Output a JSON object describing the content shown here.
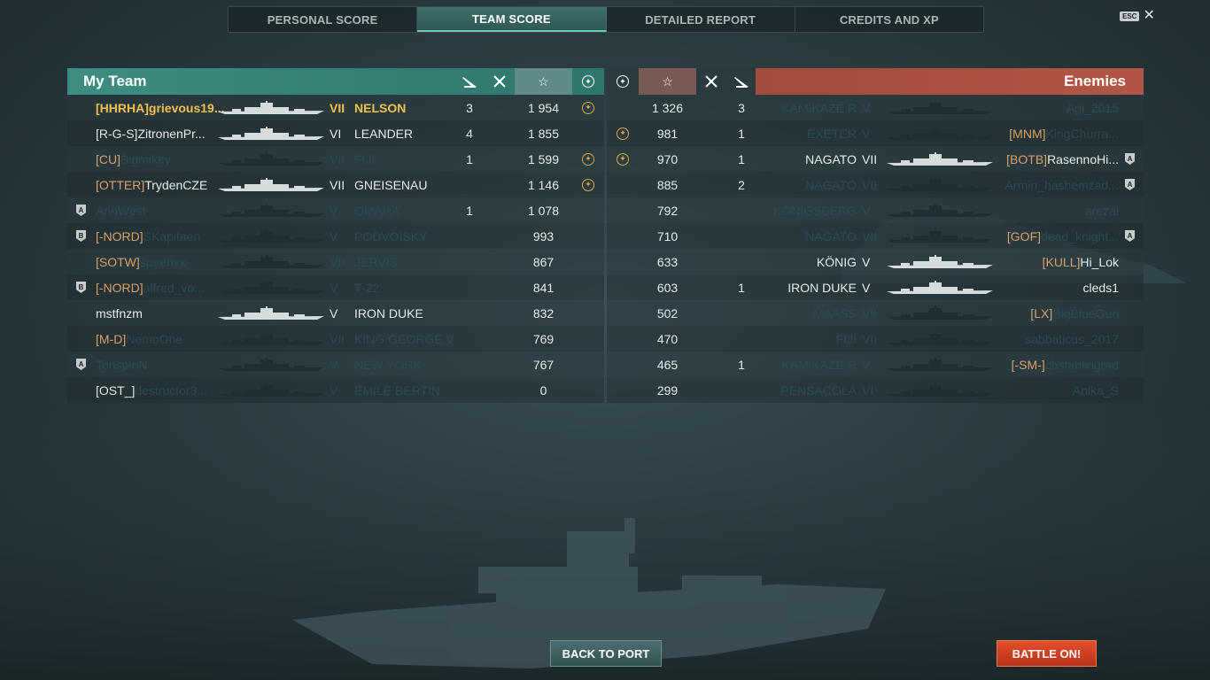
{
  "tabs": [
    {
      "label": "PERSONAL SCORE",
      "active": false
    },
    {
      "label": "TEAM SCORE",
      "active": true
    },
    {
      "label": "DETAILED REPORT",
      "active": false
    },
    {
      "label": "CREDITS AND XP",
      "active": false
    }
  ],
  "esc_label": "ESC",
  "my_team": {
    "title": "My Team",
    "header_icons": [
      "torpedo-icon",
      "planes-icon",
      "star-icon",
      "medal-icon"
    ],
    "rows": [
      {
        "badge": "",
        "clan": "[HHRHA]",
        "player": "grievous19...",
        "tier": "VII",
        "ship": "NELSON",
        "kills": "3",
        "score": "1 954",
        "medal": true,
        "style": "self"
      },
      {
        "badge": "",
        "clan": "[R-G-S]",
        "player": "ZitronenPr...",
        "tier": "VI",
        "ship": "LEANDER",
        "kills": "4",
        "score": "1 855",
        "medal": false,
        "style": "alive-white"
      },
      {
        "badge": "",
        "clan": "[CU]",
        "player": "Bigmikey",
        "tier": "VII",
        "ship": "FIJI",
        "kills": "1",
        "score": "1 599",
        "medal": true,
        "style": "dead"
      },
      {
        "badge": "",
        "clan": "[OTTER]",
        "player": "TrydenCZE",
        "tier": "VII",
        "ship": "GNEISENAU",
        "kills": "",
        "score": "1 146",
        "medal": true,
        "style": "alive"
      },
      {
        "badge": "A",
        "clan": "",
        "player": "AnnWest",
        "tier": "V",
        "ship": "OMAHA",
        "kills": "1",
        "score": "1 078",
        "medal": false,
        "style": "dead"
      },
      {
        "badge": "B",
        "clan": "[-NORD]",
        "player": "SKapitaen",
        "tier": "V",
        "ship": "PODVOISKY",
        "kills": "",
        "score": "993",
        "medal": false,
        "style": "dead"
      },
      {
        "badge": "",
        "clan": "[SOTW]",
        "player": "speenyx",
        "tier": "VII",
        "ship": "JERVIS",
        "kills": "",
        "score": "867",
        "medal": false,
        "style": "dead"
      },
      {
        "badge": "B",
        "clan": "[-NORD]",
        "player": "alfred_vo...",
        "tier": "V",
        "ship": "T-22",
        "kills": "",
        "score": "841",
        "medal": false,
        "style": "dead"
      },
      {
        "badge": "",
        "clan": "",
        "player": "mstfnzm",
        "tier": "V",
        "ship": "IRON DUKE",
        "kills": "",
        "score": "832",
        "medal": false,
        "style": "alive"
      },
      {
        "badge": "",
        "clan": "[M-D]",
        "player": "NemoOne",
        "tier": "VII",
        "ship": "KING GEORGE V",
        "kills": "",
        "score": "769",
        "medal": false,
        "style": "dead"
      },
      {
        "badge": "A",
        "clan": "",
        "player": "TonspioN",
        "tier": "V",
        "ship": "NEW YORK",
        "kills": "",
        "score": "767",
        "medal": false,
        "style": "dead"
      },
      {
        "badge": "",
        "clan": "[OST_]",
        "player": "destructor3...",
        "tier": "V",
        "ship": "ÉMILE BERTIN",
        "kills": "",
        "score": "0",
        "medal": false,
        "style": "dead-whiteclan"
      }
    ]
  },
  "enemies": {
    "title": "Enemies",
    "header_icons": [
      "medal-icon",
      "star-icon",
      "planes-icon",
      "torpedo-icon"
    ],
    "rows": [
      {
        "medal": false,
        "score": "1 326",
        "kills": "3",
        "ship": "KAMIKAZE R",
        "tier": "V",
        "clan": "",
        "player": "Agi_2015",
        "badge": "",
        "style": "dead"
      },
      {
        "medal": true,
        "score": "981",
        "kills": "1",
        "ship": "EXETER",
        "tier": "V",
        "clan": "[MNM]",
        "player": "KingChurra...",
        "badge": "",
        "style": "dead"
      },
      {
        "medal": true,
        "score": "970",
        "kills": "1",
        "ship": "NAGATO",
        "tier": "VII",
        "clan": "[BOTB]",
        "player": "RasennoHi...",
        "badge": "A",
        "style": "alive"
      },
      {
        "medal": false,
        "score": "885",
        "kills": "2",
        "ship": "NAGATO",
        "tier": "VII",
        "clan": "",
        "player": "Armin_hashemzad...",
        "badge": "A",
        "style": "dead"
      },
      {
        "medal": false,
        "score": "792",
        "kills": "",
        "ship": "KÖNIGSBERG",
        "tier": "V",
        "clan": "",
        "player": "arezal",
        "badge": "",
        "style": "dead"
      },
      {
        "medal": false,
        "score": "710",
        "kills": "",
        "ship": "NAGATO",
        "tier": "VII",
        "clan": "[GOF]",
        "player": "dead_knight...",
        "badge": "A",
        "style": "dead"
      },
      {
        "medal": false,
        "score": "633",
        "kills": "",
        "ship": "KÖNIG",
        "tier": "V",
        "clan": "[KULL]",
        "player": "Hi_Lok",
        "badge": "",
        "style": "alive"
      },
      {
        "medal": false,
        "score": "603",
        "kills": "1",
        "ship": "IRON DUKE",
        "tier": "V",
        "clan": "",
        "player": "cleds1",
        "badge": "",
        "style": "alive"
      },
      {
        "medal": false,
        "score": "502",
        "kills": "",
        "ship": "MAASS",
        "tier": "VII",
        "clan": "[LX]",
        "player": "BigBlueGun",
        "badge": "",
        "style": "dead"
      },
      {
        "medal": false,
        "score": "470",
        "kills": "",
        "ship": "FIJI",
        "tier": "VII",
        "clan": "",
        "player": "sabbaticus_2017",
        "badge": "",
        "style": "dead"
      },
      {
        "medal": false,
        "score": "465",
        "kills": "1",
        "ship": "KAMIKAZE R",
        "tier": "V",
        "clan": "[-SM-]",
        "player": "chstahlingrad",
        "badge": "",
        "style": "dead"
      },
      {
        "medal": false,
        "score": "299",
        "kills": "",
        "ship": "PENSACOLA",
        "tier": "VI",
        "clan": "",
        "player": "Anika_S",
        "badge": "",
        "style": "dead"
      }
    ]
  },
  "buttons": {
    "back": "BACK TO PORT",
    "battle": "BATTLE ON!"
  },
  "colors": {
    "my_team": "#3d8d80",
    "enemies": "#b35544",
    "self": "#f4c04e",
    "clan": "#d9a06a",
    "dead": "#2c4850",
    "battle_button": "#d8442a"
  }
}
